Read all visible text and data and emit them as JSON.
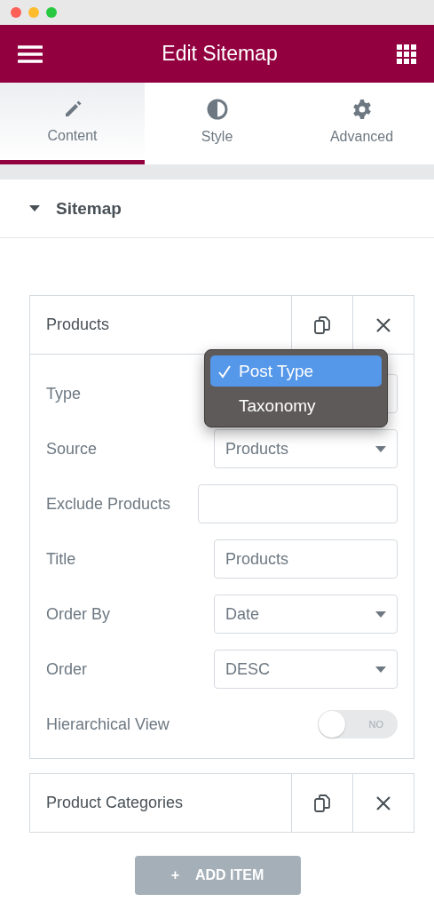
{
  "header": {
    "title": "Edit Sitemap"
  },
  "tabs": [
    {
      "label": "Content",
      "selected": true
    },
    {
      "label": "Style",
      "selected": false
    },
    {
      "label": "Advanced",
      "selected": false
    }
  ],
  "section": {
    "title": "Sitemap",
    "expanded": true
  },
  "items": [
    {
      "title": "Products",
      "fields": [
        {
          "kind": "select",
          "label": "Type",
          "open": true,
          "options": [
            {
              "label": "Post Type",
              "selected": true
            },
            {
              "label": "Taxonomy",
              "selected": false
            }
          ]
        },
        {
          "kind": "select",
          "label": "Source",
          "value": "Products"
        },
        {
          "kind": "text",
          "label": "Exclude Products"
        },
        {
          "kind": "text",
          "label": "Title",
          "value": "Products"
        },
        {
          "kind": "select",
          "label": "Order By",
          "value": "Date"
        },
        {
          "kind": "select",
          "label": "Order",
          "value": "DESC"
        },
        {
          "kind": "toggle",
          "label": "Hierarchical View",
          "on": false,
          "text": "NO"
        }
      ]
    },
    {
      "title": "Product Categories"
    }
  ],
  "add_button": {
    "icon": "+",
    "label": "ADD ITEM"
  }
}
